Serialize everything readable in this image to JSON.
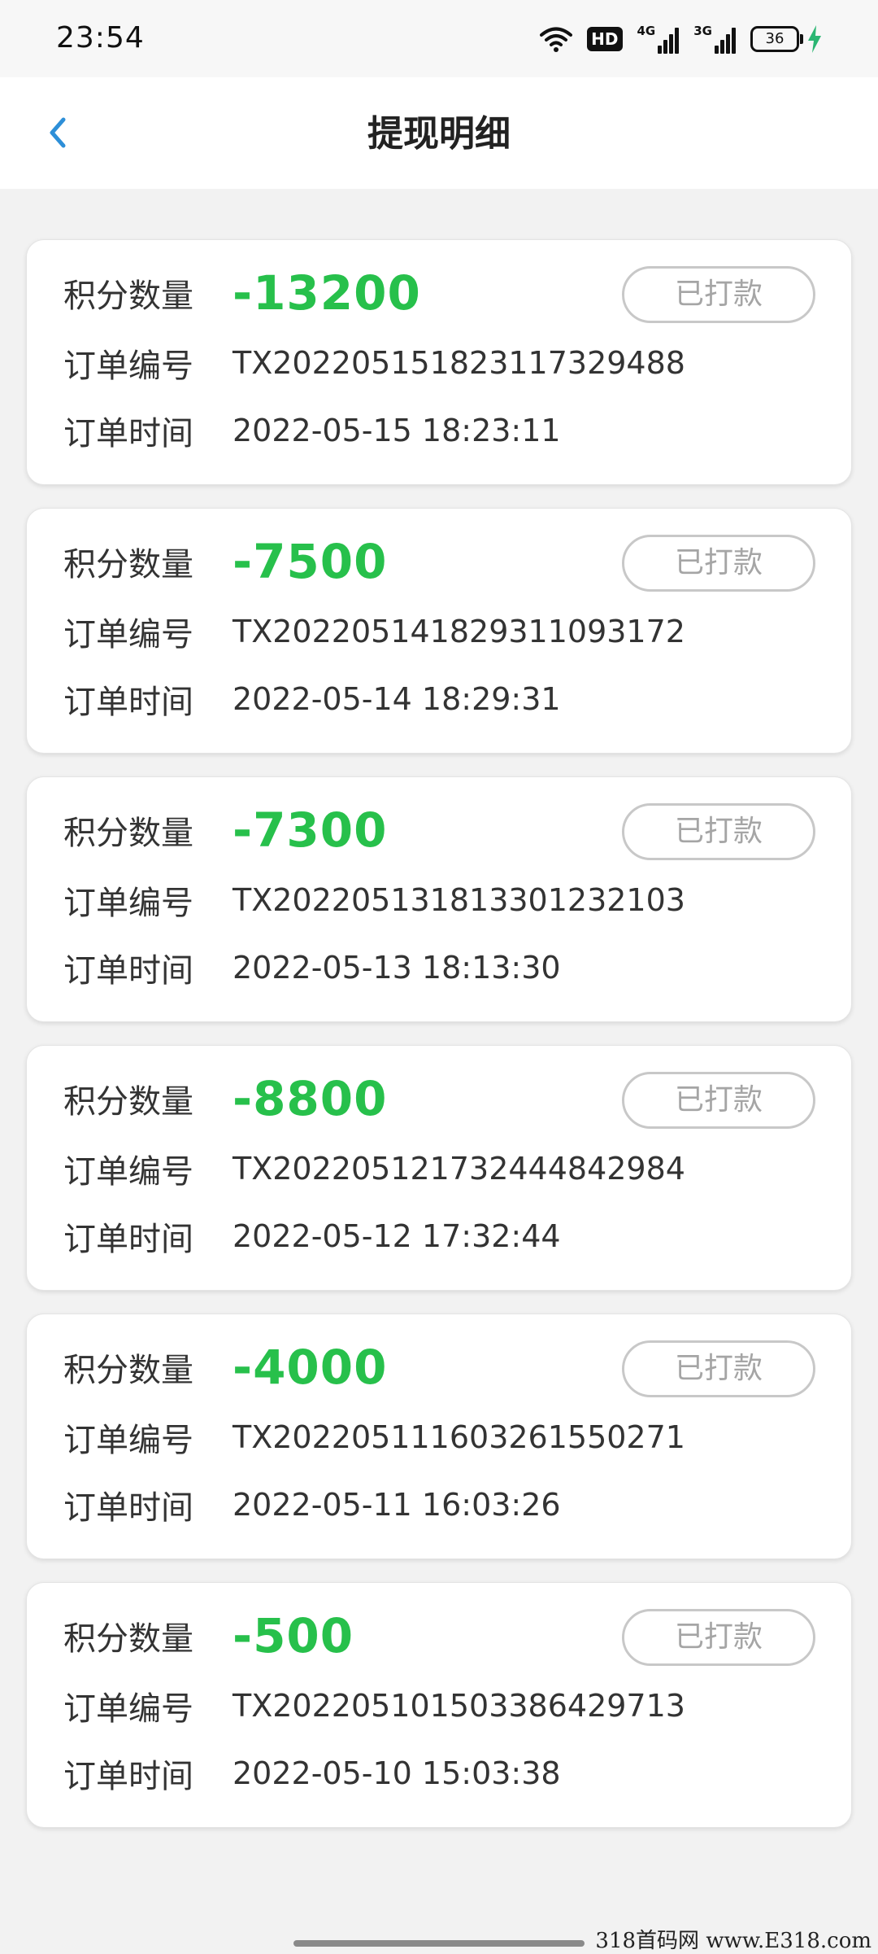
{
  "status_bar": {
    "time": "23:54",
    "hd_badge": "HD",
    "network_1": "4G",
    "network_2": "3G",
    "battery": "36"
  },
  "header": {
    "title": "提现明细",
    "back_icon": "chevron-left-icon"
  },
  "labels": {
    "points": "积分数量",
    "order_no": "订单编号",
    "order_time": "订单时间"
  },
  "records": [
    {
      "points": "-13200",
      "order_no": "TX202205151823117329488",
      "order_time": "2022-05-15 18:23:11",
      "status": "已打款"
    },
    {
      "points": "-7500",
      "order_no": "TX202205141829311093172",
      "order_time": "2022-05-14 18:29:31",
      "status": "已打款"
    },
    {
      "points": "-7300",
      "order_no": "TX202205131813301232103",
      "order_time": "2022-05-13 18:13:30",
      "status": "已打款"
    },
    {
      "points": "-8800",
      "order_no": "TX202205121732444842984",
      "order_time": "2022-05-12 17:32:44",
      "status": "已打款"
    },
    {
      "points": "-4000",
      "order_no": "TX202205111603261550271",
      "order_time": "2022-05-11 16:03:26",
      "status": "已打款"
    },
    {
      "points": "-500",
      "order_no": "TX202205101503386429713",
      "order_time": "2022-05-10 15:03:38",
      "status": "已打款"
    }
  ],
  "colors": {
    "accent_green": "#27c04b",
    "back_blue": "#2d8fd8",
    "status_gray": "#a5a5a5"
  },
  "watermark": "318首码网 www.E318.com"
}
